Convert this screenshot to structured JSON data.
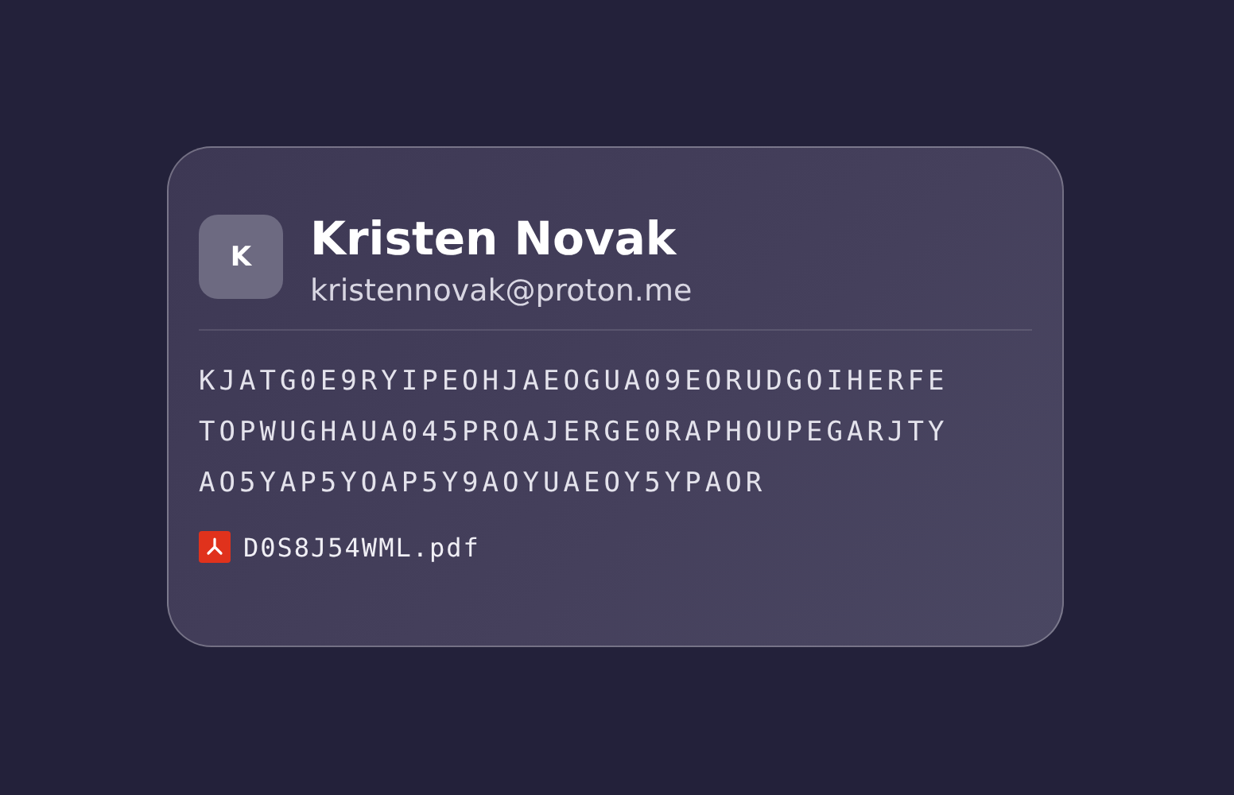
{
  "contact": {
    "initial": "K",
    "name": "Kristen Novak",
    "email": "kristennovak@proton.me"
  },
  "message_lines": [
    "KJATG0E9RYIPEOHJAEOGUA09EORUDGOIHERFE",
    "TOPWUGHAUA045PROAJERGE0RAPHOUPEGARJTY",
    "AO5YAP5YOAP5Y9AOYUAEOY5YPAOR"
  ],
  "attachment": {
    "kind": "pdf",
    "filename": "D0S8J54WML.pdf"
  }
}
